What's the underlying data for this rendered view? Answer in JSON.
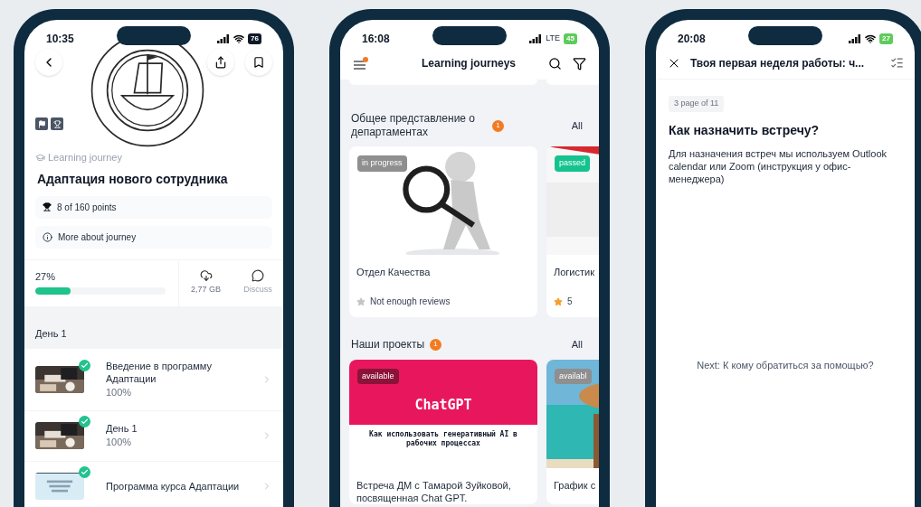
{
  "phones": [
    {
      "kind": "journey",
      "status": {
        "time": "10:35",
        "wifi": true,
        "battery": "76",
        "charging": false
      },
      "label": "Learning journey",
      "title": "Адаптация нового сотрудника",
      "points": "8 of 160 points",
      "more": "More about journey",
      "progress": {
        "reading": "27%",
        "level": 0.27
      },
      "download": "2,77 GB",
      "discuss": "Discuss",
      "section": "День 1",
      "lessons": [
        {
          "title": "Введение в программу Адаптации",
          "progress": "100%",
          "done": true
        },
        {
          "title": "День 1",
          "progress": "100%",
          "done": true
        },
        {
          "title": "Программа курса Адаптации",
          "done": true
        }
      ]
    },
    {
      "kind": "catalog",
      "status": {
        "time": "16:08",
        "network": "LTE",
        "battery": "45",
        "charging": true
      },
      "title": "Learning journeys",
      "sections": [
        {
          "title": "Общее представление о департаментах",
          "count": "1",
          "all": "All",
          "cards": [
            {
              "kind": "picture",
              "tag": "in progress",
              "color": "#8f8f8f",
              "title": "Отдел Качества",
              "rating": "Not enough reviews",
              "rated": false
            },
            {
              "kind": "picture",
              "tag": "passed",
              "color": "#14c38e",
              "title": "Логистик",
              "rating": "5",
              "rated": true
            }
          ]
        },
        {
          "title": "Наши проекты",
          "count": "1",
          "all": "All",
          "cards": [
            {
              "kind": "cover",
              "tag": "available",
              "color": "#8b1339",
              "cover_title": "ChatGPT",
              "cover_subtitle": "Как использовать генеративный AI в рабочих процессах",
              "title": "Встреча ДМ с Тамарой Зуйковой, посвященная Chat GPT."
            },
            {
              "kind": "picture",
              "tag": "availabl",
              "color": "#8f8f8f",
              "title": "График с"
            }
          ]
        }
      ]
    },
    {
      "kind": "reader",
      "status": {
        "time": "20:08",
        "wifi": true,
        "battery": "27",
        "charging": true
      },
      "title": "Твоя первая неделя работы: ч...",
      "page": "3 page of 11",
      "heading": "Как назначить встречу?",
      "body": "Для назначения встреч мы используем Outlook calendar или Zoom (инструкция у офис-менеджера)",
      "next": "Next: К кому обратиться за помощью?"
    }
  ]
}
